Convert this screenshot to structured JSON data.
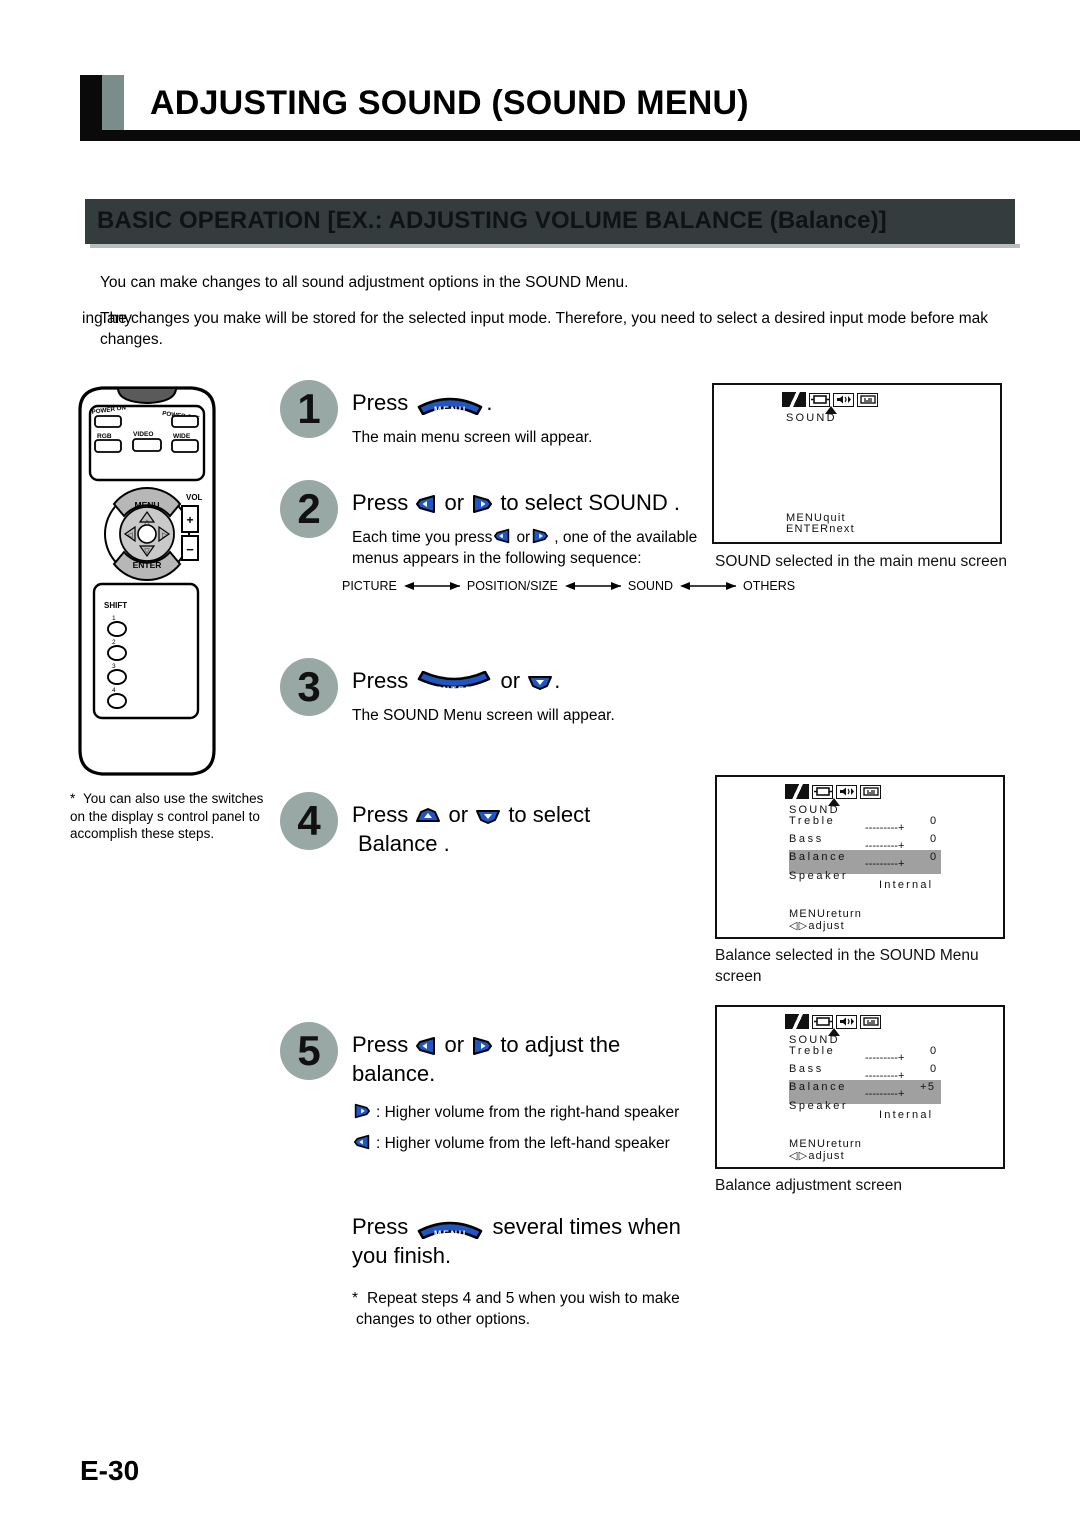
{
  "header": {
    "title": "ADJUSTING SOUND (SOUND MENU)",
    "subtitle": "BASIC OPERATION [EX.: ADJUSTING VOLUME BALANCE (Balance)]"
  },
  "intro": {
    "p1": "You can make changes to all sound adjustment options in the SOUND Menu.",
    "p2_a": "The changes you make will be stored for the selected input mode.  Therefore, you need to select a desired input mode before mak",
    "p2_overlap": "ing any",
    "p2_b": "changes."
  },
  "remote": {
    "power_on": "POWER ON",
    "power_off": "POWER OFF",
    "rgb": "RGB",
    "video": "VIDEO",
    "wide": "WIDE",
    "menu": "MENU",
    "vol": "VOL",
    "enter": "ENTER",
    "shift": "SHIFT",
    "num1": "1",
    "num2": "2",
    "num3": "3",
    "num4": "4",
    "plus": "+",
    "minus": "-"
  },
  "note_left": {
    "star": "*",
    "text": "You can also use the switches on the display s control panel to accomplish these steps."
  },
  "steps": [
    {
      "number": "1",
      "main_pre": "Press",
      "button": "MENU",
      "main_post": ".",
      "sub": "The main menu screen will appear."
    },
    {
      "number": "2",
      "main_pre": "Press",
      "main_mid": "or",
      "main_post": "to select  SOUND .",
      "sub_a": "Each time you press",
      "sub_b": "or",
      "sub_c": ", one of the available",
      "sub_d": "menus appears in the following sequence:",
      "sequence": [
        "PICTURE",
        "POSITION/SIZE",
        "SOUND",
        "OTHERS"
      ]
    },
    {
      "number": "3",
      "main_pre": "Press",
      "button": "ENTER",
      "main_mid": "or",
      "main_post": ".",
      "sub": "The SOUND Menu screen will appear."
    },
    {
      "number": "4",
      "main_pre": "Press",
      "main_mid": "or",
      "main_post": "to select",
      "main_line2": "Balance ."
    },
    {
      "number": "5",
      "main_pre": "Press",
      "main_mid": "or",
      "main_post": "to adjust the",
      "main_line2": "balance.",
      "legend_right": ": Higher volume from the right-hand speaker",
      "legend_left": ": Higher volume from the left-hand speaker"
    }
  ],
  "finish": {
    "pre": "Press",
    "button": "MENU",
    "post_line1": "several times when",
    "post_line2": "you finish.",
    "note_star": "*",
    "note_line1": "Repeat steps 4 and 5 when you wish to make",
    "note_line2": "changes to other options."
  },
  "osd_screens": [
    {
      "id": "main-menu",
      "menu_title": "SOUND",
      "footer_line1": "MENUquit",
      "footer_line2": "ENTERnext",
      "caption": "SOUND  selected in the main menu screen"
    },
    {
      "id": "sound-menu-balance-selected",
      "menu_title": "SOUND",
      "rows": [
        {
          "label": "Treble",
          "value": "0",
          "bar": "---------+",
          "highlighted": false
        },
        {
          "label": "Bass",
          "value": "0",
          "bar": "---------+",
          "highlighted": false
        },
        {
          "label": "Balance",
          "value": "0",
          "bar": "---------+",
          "highlighted": true
        },
        {
          "label": "Speaker",
          "value": "Internal",
          "bar": "",
          "highlighted": false
        }
      ],
      "footer_line1": "MENUreturn",
      "footer_line2": "adjust",
      "caption_line1": "Balance  selected in the SOUND Menu",
      "caption_line2": "screen"
    },
    {
      "id": "balance-adjustment",
      "menu_title": "SOUND",
      "rows": [
        {
          "label": "Treble",
          "value": "0",
          "bar": "---------+",
          "highlighted": false
        },
        {
          "label": "Bass",
          "value": "0",
          "bar": "---------+",
          "highlighted": false
        },
        {
          "label": "Balance",
          "value": "+5",
          "bar": "---------+",
          "highlighted": true
        },
        {
          "label": "Speaker",
          "value": "Internal",
          "bar": "",
          "highlighted": false
        }
      ],
      "footer_line1": "MENUreturn",
      "footer_line2": "adjust",
      "caption_line1": "Balance  adjustment screen"
    }
  ],
  "footer": {
    "page": "E-30"
  },
  "colors": {
    "step_circle": "#98a8a4",
    "button_blue": "#1f56c4",
    "header_gray": "#7b8d8a",
    "subheader": "#343c3e",
    "osd_highlight": "#a0a0a0"
  }
}
